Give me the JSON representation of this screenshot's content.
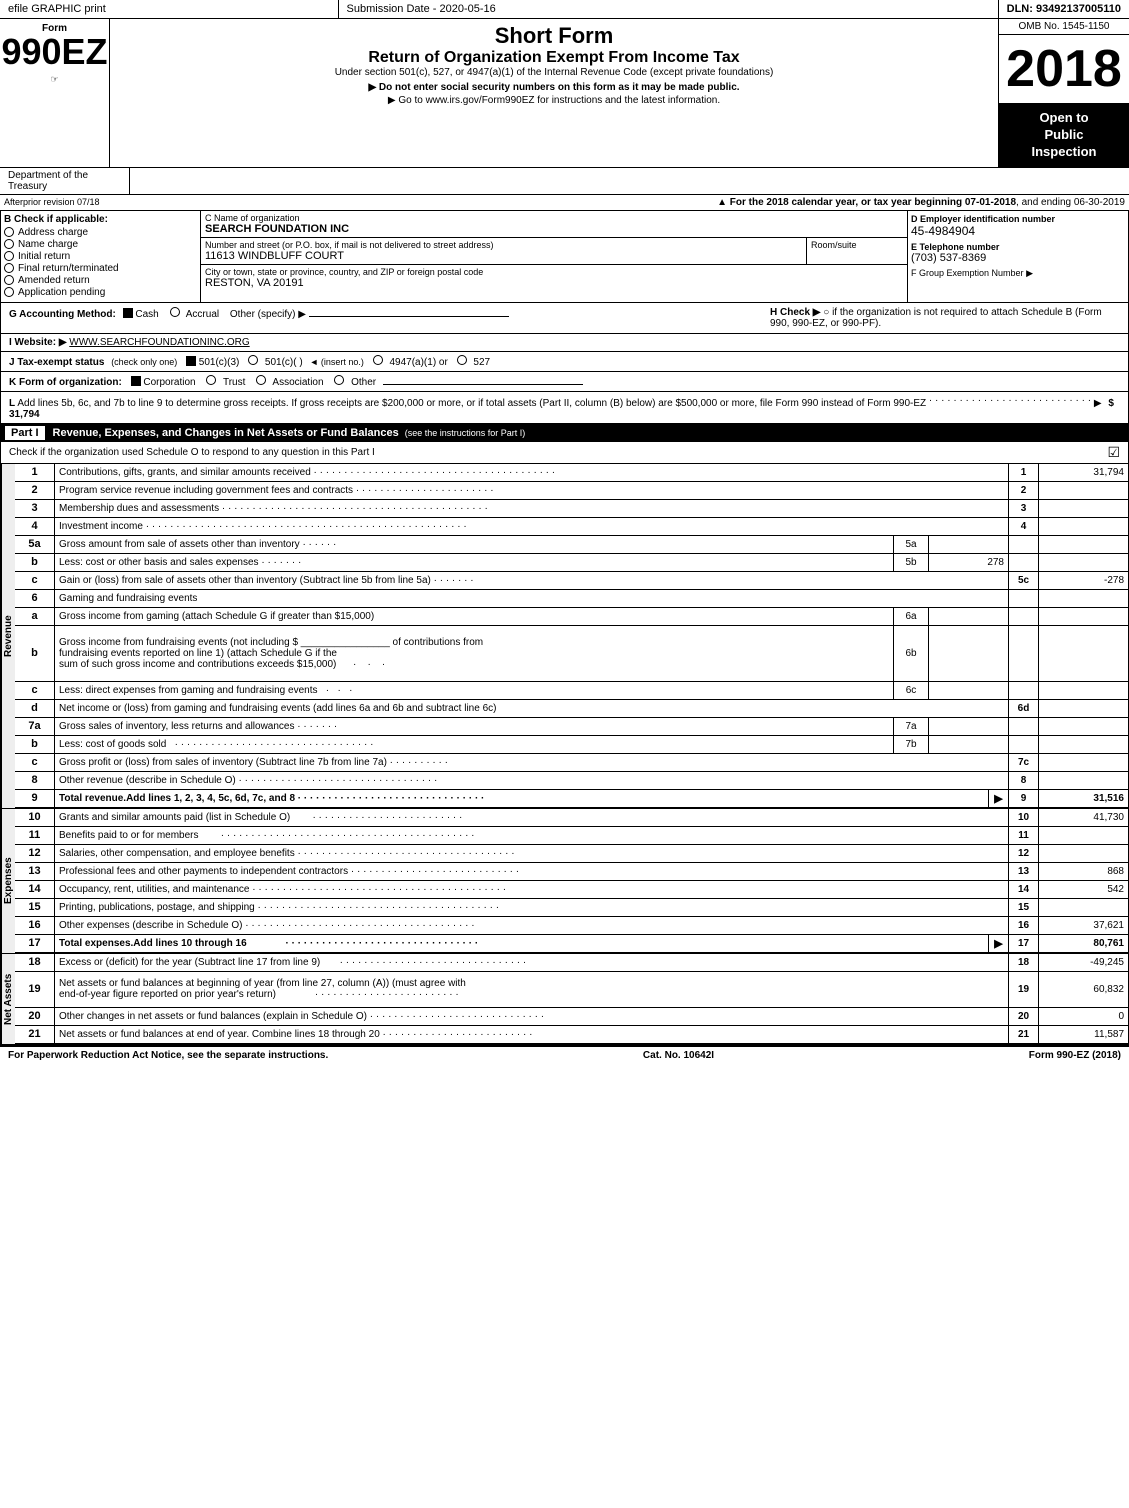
{
  "topBar": {
    "left": "efile GRAPHIC print",
    "middle": "Submission Date - 2020-05-16",
    "right": "DLN: 93492137005110"
  },
  "header": {
    "formId": "990EZ",
    "formLabel": "Form",
    "shortFormTitle": "Short Form",
    "returnTitle": "Return of Organization Exempt From Income Tax",
    "underSection": "Under section 501(c), 527, or 4947(a)(1) of the Internal Revenue Code (except private foundations)",
    "doNotEnter": "▶ Do not enter social security numbers on this form as it may be made public.",
    "goTo": "▶ Go to www.irs.gov/Form990EZ for instructions and the latest information.",
    "year": "2018",
    "ombNo": "OMB No. 1545-1150",
    "openToPublic": "Open to\nPublic\nInspection"
  },
  "deptTreasury": {
    "left": "Department of the Treasury",
    "center": ""
  },
  "forYear": {
    "text": "▲ For the 2018 calendar year, or tax year beginning 07-01-2018",
    "textEnd": ", and ending 06-30-2019",
    "altText": "Afterprior revision 07/18"
  },
  "checkIfApplicable": {
    "title": "B Check if applicable:",
    "items": [
      "Address charge",
      "Name charge",
      "Initial return",
      "Final return/terminated",
      "Amended return",
      "Application pending"
    ]
  },
  "orgInfo": {
    "nameLabelC": "C Name of organization",
    "name": "SEARCH FOUNDATION INC",
    "addressLabel": "Number and street (or P.O. box, if mail is not delivered to street address)",
    "address": "11613 WINDBLUFF COURT",
    "roomSuiteLabel": "Room/suite",
    "roomSuite": "",
    "cityLabel": "City or town, state or province, country, and ZIP or foreign postal code",
    "city": "RESTON, VA  20191"
  },
  "einSection": {
    "labelD": "D Employer identification number",
    "ein": "45-4984904",
    "labelE": "E Telephone number",
    "phone": "(703) 537-8369",
    "labelF": "F Group Exemption\nNumber",
    "arrow": "▶"
  },
  "accounting": {
    "gLabel": "G Accounting Method:",
    "cashChecked": true,
    "accrualChecked": false,
    "otherLabel": "Other (specify) ▶",
    "hLabel": "H  Check ▶",
    "hText": "○  if the organization is not required to attach Schedule B (Form 990, 990-EZ, or 990-PF)."
  },
  "website": {
    "iLabel": "I  Website: ▶",
    "url": "WWW.SEARCHFOUNDATIONINC.ORG"
  },
  "taxExempt": {
    "jLabel": "J Tax-exempt status",
    "jNote": "(check only one)",
    "options": [
      "501(c)(3)",
      "501(c)(  )",
      "4947(a)(1) or",
      "527"
    ],
    "selected": "501(c)(3)"
  },
  "formOrg": {
    "kLabel": "K Form of organization:",
    "options": [
      "Corporation",
      "Trust",
      "Association",
      "Other"
    ],
    "selected": "Corporation"
  },
  "lLine": {
    "text": "L Add lines 5b, 6c, and 7b to line 9 to determine gross receipts. If gross receipts are $200,000 or more, or if total assets (Part II, column (B) below) are $500,000 or more, file Form 990 instead of Form 990-EZ",
    "dotFill": "· · · · · · · · · · · · · · · · · · · · · · · · · · ·",
    "arrow": "▶",
    "value": "$ 31,794"
  },
  "partI": {
    "label": "Part I",
    "title": "Revenue, Expenses, and Changes in Net Assets or Fund Balances",
    "titleNote": "(see the instructions for Part I)",
    "checkScheduleO": "Check if the organization used Schedule O to respond to any question in this Part I",
    "checkMark": "☑",
    "rows": [
      {
        "num": "1",
        "desc": "Contributions, gifts, grants, and similar amounts received",
        "dots": "· · · · · · · · · · · · · · · · · · · · · · · · · · · · · · · · · · · · · · · ·",
        "lineRef": "1",
        "amount": "31,794"
      },
      {
        "num": "2",
        "desc": "Program service revenue including government fees and contracts",
        "dots": "· · · · · · · · · · · · · · · · · · · · · ·",
        "lineRef": "2",
        "amount": ""
      },
      {
        "num": "3",
        "desc": "Membership dues and assessments",
        "dots": "· · · · · · · · · · · · · · · · · · · · · · · · · · · · · · · · · · · · · · · · · · · ·",
        "lineRef": "3",
        "amount": ""
      },
      {
        "num": "4",
        "desc": "Investment income",
        "dots": "· · · · · · · · · · · · · · · · · · · · · · · · · · · · · · · · · · · · · · · · · · · · · · · · · · · · ·",
        "lineRef": "4",
        "amount": ""
      },
      {
        "num": "5a",
        "desc": "Gross amount from sale of assets other than inventory",
        "dots": "· · · · · ·",
        "lineRef": "5a",
        "amount": "",
        "midRef": true
      },
      {
        "num": "b",
        "desc": "Less: cost or other basis and sales expenses",
        "dots": "· · · · · · ·",
        "lineRef": "5b",
        "amount": "278",
        "midRef": true
      },
      {
        "num": "c",
        "desc": "Gain or (loss) from sale of assets other than inventory (Subtract line 5b from line 5a)",
        "dots": "· · · · · · ·",
        "lineRef": "5c",
        "amount": "-278"
      },
      {
        "num": "6",
        "desc": "Gaming and fundraising events",
        "dots": "",
        "lineRef": "",
        "amount": ""
      },
      {
        "num": "a",
        "desc": "Gross income from gaming (attach Schedule G if greater than $15,000)",
        "dots": "",
        "lineRef": "6a",
        "amount": "",
        "midRef": true
      },
      {
        "num": "b",
        "desc": "Gross income from fundraising events (not including $____________ of contributions from fundraising events reported on line 1) (attach Schedule G if the sum of such gross income and contributions exceeds $15,000)",
        "dots": "",
        "lineRef": "6b",
        "amount": "",
        "midRef": true,
        "multiline": true
      },
      {
        "num": "c",
        "desc": "Less: direct expenses from gaming and fundraising events",
        "dots": "· · ·",
        "lineRef": "6c",
        "amount": "",
        "midRef": true
      },
      {
        "num": "d",
        "desc": "Net income or (loss) from gaming and fundraising events (add lines 6a and 6b and subtract line 6c)",
        "dots": "",
        "lineRef": "6d",
        "amount": ""
      },
      {
        "num": "7a",
        "desc": "Gross sales of inventory, less returns and allowances",
        "dots": "· · · · · · ·",
        "lineRef": "7a",
        "amount": "",
        "midRef": true
      },
      {
        "num": "b",
        "desc": "Less: cost of goods sold",
        "dots": "· · · · · · · · · · · · · · · · · · · · · · · · · · · · · · · · · ·",
        "lineRef": "7b",
        "amount": "",
        "midRef": true
      },
      {
        "num": "c",
        "desc": "Gross profit or (loss) from sales of inventory (Subtract line 7b from line 7a)",
        "dots": "· · · · · · · · · ·",
        "lineRef": "7c",
        "amount": ""
      },
      {
        "num": "8",
        "desc": "Other revenue (describe in Schedule O)",
        "dots": "· · · · · · · · · · · · · · · · · · · · · · · · · · · · · · · · · ·",
        "lineRef": "8",
        "amount": ""
      },
      {
        "num": "9",
        "desc": "Total revenue. Add lines 1, 2, 3, 4, 5c, 6d, 7c, and 8",
        "dots": "· · · · · · · · · · · · · · · · · · · · · · · · · · · · · · · · ·",
        "lineRef": "9",
        "amount": "31,516",
        "bold": true,
        "arrow": true
      }
    ],
    "expenseRows": [
      {
        "num": "10",
        "desc": "Grants and similar amounts paid (list in Schedule O)",
        "dots": "· · · · · · · · · · · · · · · · · · · · · · · · ·",
        "lineRef": "10",
        "amount": "41,730"
      },
      {
        "num": "11",
        "desc": "Benefits paid to or for members",
        "dots": "· · · · · · · · · · · · · · · · · · · · · · · · · · · · · · · · · · · · · · · · · ·",
        "lineRef": "11",
        "amount": ""
      },
      {
        "num": "12",
        "desc": "Salaries, other compensation, and employee benefits",
        "dots": "· · · · · · · · · · · · · · · · · · · · · · · · · · · · · · · · · · · ·",
        "lineRef": "12",
        "amount": ""
      },
      {
        "num": "13",
        "desc": "Professional fees and other payments to independent contractors",
        "dots": "· · · · · · · · · · · · · · · · · · · · · · · · · · · ·",
        "lineRef": "13",
        "amount": "868"
      },
      {
        "num": "14",
        "desc": "Occupancy, rent, utilities, and maintenance",
        "dots": "· · · · · · · · · · · · · · · · · · · · · · · · · · · · · · · · · · · · · · · · · ·",
        "lineRef": "14",
        "amount": "542"
      },
      {
        "num": "15",
        "desc": "Printing, publications, postage, and shipping",
        "dots": "· · · · · · · · · · · · · · · · · · · · · · · · · · · · · · · · · · · · · · · ·",
        "lineRef": "15",
        "amount": ""
      },
      {
        "num": "16",
        "desc": "Other expenses (describe in Schedule O)",
        "dots": "· · · · · · · · · · · · · · · · · · · · · · · · · · · · · · · · · · · · · ·",
        "lineRef": "16",
        "amount": "37,621"
      },
      {
        "num": "17",
        "desc": "Total expenses. Add lines 10 through 16",
        "dots": "· · · · · · · · · · · · · · · · · · · · · · · · · · · · · · · · · · · · · ·",
        "lineRef": "17",
        "amount": "80,761",
        "bold": true,
        "arrow": true
      }
    ],
    "netAssetsRows": [
      {
        "num": "18",
        "desc": "Excess or (deficit) for the year (Subtract line 17 from line 9)",
        "dots": "· · · · · · · · · · · · · · · · · · · · · · · · · · · · · · ·",
        "lineRef": "18",
        "amount": "-49,245"
      },
      {
        "num": "19",
        "desc": "Net assets or fund balances at beginning of year (from line 27, column (A)) (must agree with end-of-year figure reported on prior year's return)",
        "dots": "· · · · · · · · · · · · · · · · · · · · · · · ·",
        "lineRef": "19",
        "amount": "60,832",
        "multiline": true
      },
      {
        "num": "20",
        "desc": "Other changes in net assets or fund balances (explain in Schedule O)",
        "dots": "· · · · · · · · · · · · · · · · · · · · · · · · · · · · ·",
        "lineRef": "20",
        "amount": "0"
      },
      {
        "num": "21",
        "desc": "Net assets or fund balances at end of year. Combine lines 18 through 20",
        "dots": "· · · · · · · · · · · · · · · · · · · · · · · · · ·",
        "lineRef": "21",
        "amount": "11,587"
      }
    ]
  },
  "footer": {
    "left": "For Paperwork Reduction Act Notice, see the separate instructions.",
    "middle": "Cat. No. 10642I",
    "right": "Form 990-EZ (2018)"
  }
}
